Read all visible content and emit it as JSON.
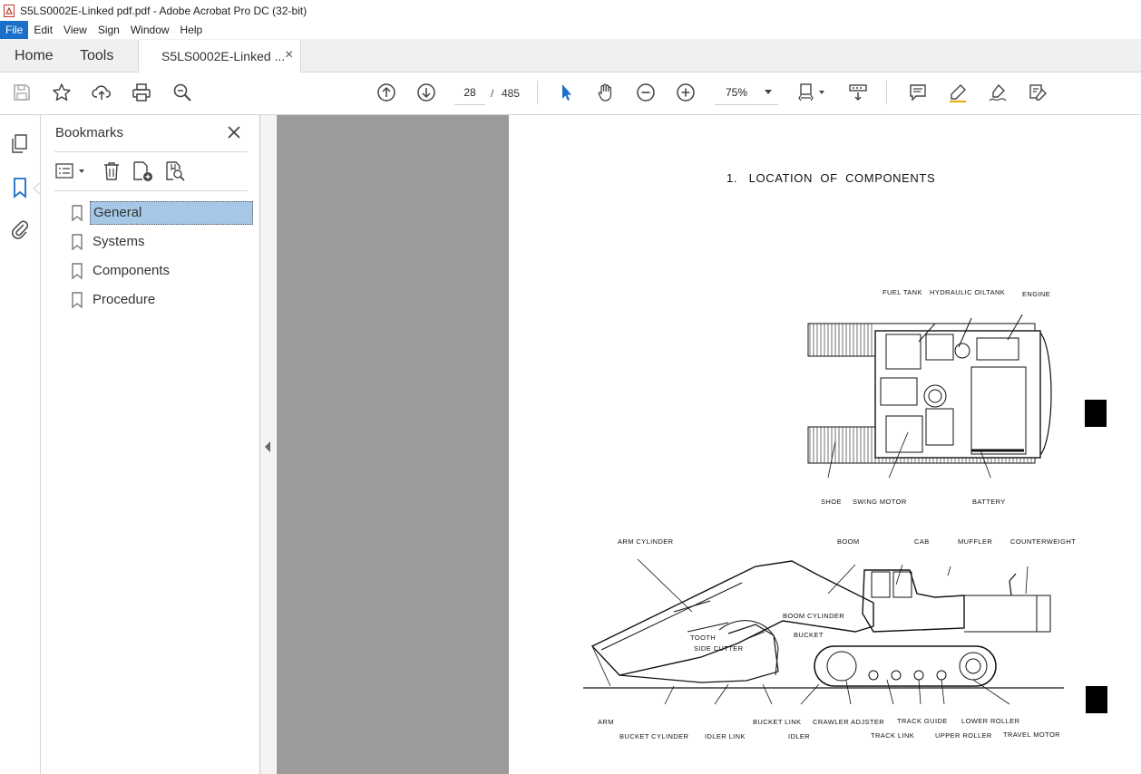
{
  "window": {
    "title": "S5LS0002E-Linked pdf.pdf - Adobe Acrobat Pro DC (32-bit)"
  },
  "menu": {
    "items": [
      "File",
      "Edit",
      "View",
      "Sign",
      "Window",
      "Help"
    ]
  },
  "tabs": {
    "home": "Home",
    "tools": "Tools",
    "document": "S5LS0002E-Linked ...",
    "close_glyph": "×"
  },
  "toolbar": {
    "current_page": "28",
    "page_separator": "/",
    "total_pages": "485",
    "zoom": "75%"
  },
  "bookmarks": {
    "title": "Bookmarks",
    "items": [
      "General",
      "Systems",
      "Components",
      "Procedure"
    ],
    "selected": "General"
  },
  "document": {
    "section_title": "1.   LOCATION  OF  COMPONENTS",
    "top_view_labels": {
      "fuel_tank": "FUEL TANK",
      "hydraulic_oiltank": "HYDRAULIC OILTANK",
      "engine": "ENGINE",
      "shoe": "SHOE",
      "swing_motor": "SWING MOTOR",
      "battery": "BATTERY"
    },
    "side_view_labels": {
      "arm_cylinder": "ARM CYLINDER",
      "boom": "BOOM",
      "cab": "CAB",
      "muffler": "MUFFLER",
      "counterweight": "COUNTERWEIGHT",
      "boom_cylinder": "BOOM CYLINDER",
      "tooth": "TOOTH",
      "bucket": "BUCKET",
      "side_cutter": "SIDE CUTTER",
      "arm": "ARM",
      "bucket_link": "BUCKET LINK",
      "crawler_adjster": "CRAWLER ADJSTER",
      "track_guide": "TRACK GUIDE",
      "lower_roller": "LOWER ROLLER",
      "bucket_cylinder": "BUCKET CYLINDER",
      "idler_link": "IDLER LINK",
      "idler": "IDLER",
      "track_link": "TRACK LINK",
      "upper_roller": "UPPER ROLLER",
      "travel_motor": "TRAVEL MOTOR"
    }
  },
  "colors": {
    "accent": "#1a6fc9",
    "selection": "#a6c8e6",
    "doc_background": "#9b9b9b"
  }
}
